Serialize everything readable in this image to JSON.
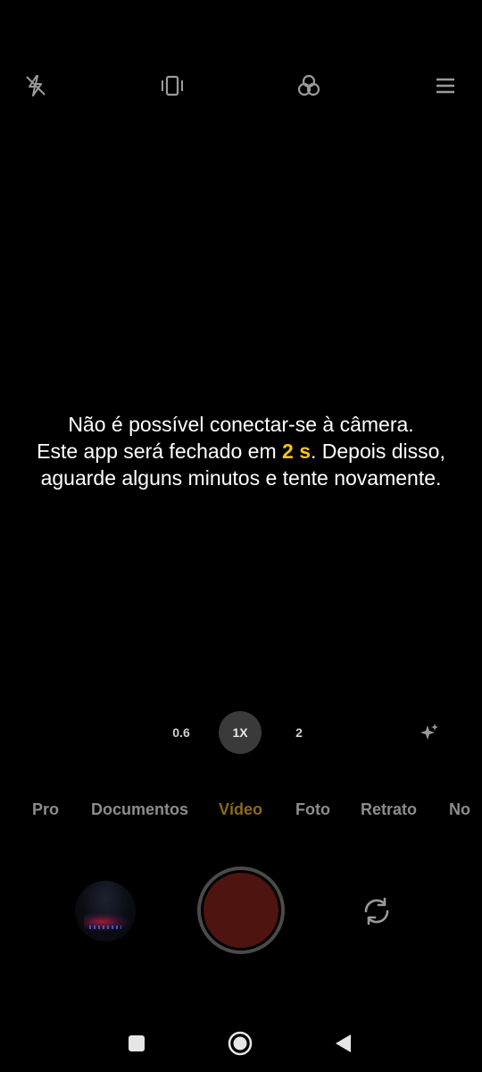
{
  "top_bar": {
    "icons": [
      "flash-off-icon",
      "stabilization-icon",
      "filters-icon",
      "menu-icon"
    ]
  },
  "error": {
    "line1": "Não é possível conectar-se à câmera.",
    "line2_prefix": "Este app será fechado em ",
    "countdown": "2 s",
    "line2_suffix": ". Depois disso,",
    "line3": "aguarde alguns minutos e tente novamente.",
    "countdown_color": "#f5c518"
  },
  "zoom": {
    "options": [
      "0.6",
      "1X",
      "2"
    ],
    "selected": "1X",
    "ai_icon": "ai-sparkle-icon"
  },
  "modes": {
    "items": [
      "Pro",
      "Documentos",
      "Vídeo",
      "Foto",
      "Retrato",
      "No"
    ],
    "selected": "Vídeo",
    "selected_color": "#8a6a1c"
  },
  "controls": {
    "gallery_icon": "gallery-thumbnail",
    "shutter_icon": "record-button",
    "switch_icon": "switch-camera-icon",
    "shutter_color": "#4e1410"
  },
  "nav": {
    "icons": [
      "recents-square-icon",
      "home-circle-icon",
      "back-triangle-icon"
    ]
  }
}
